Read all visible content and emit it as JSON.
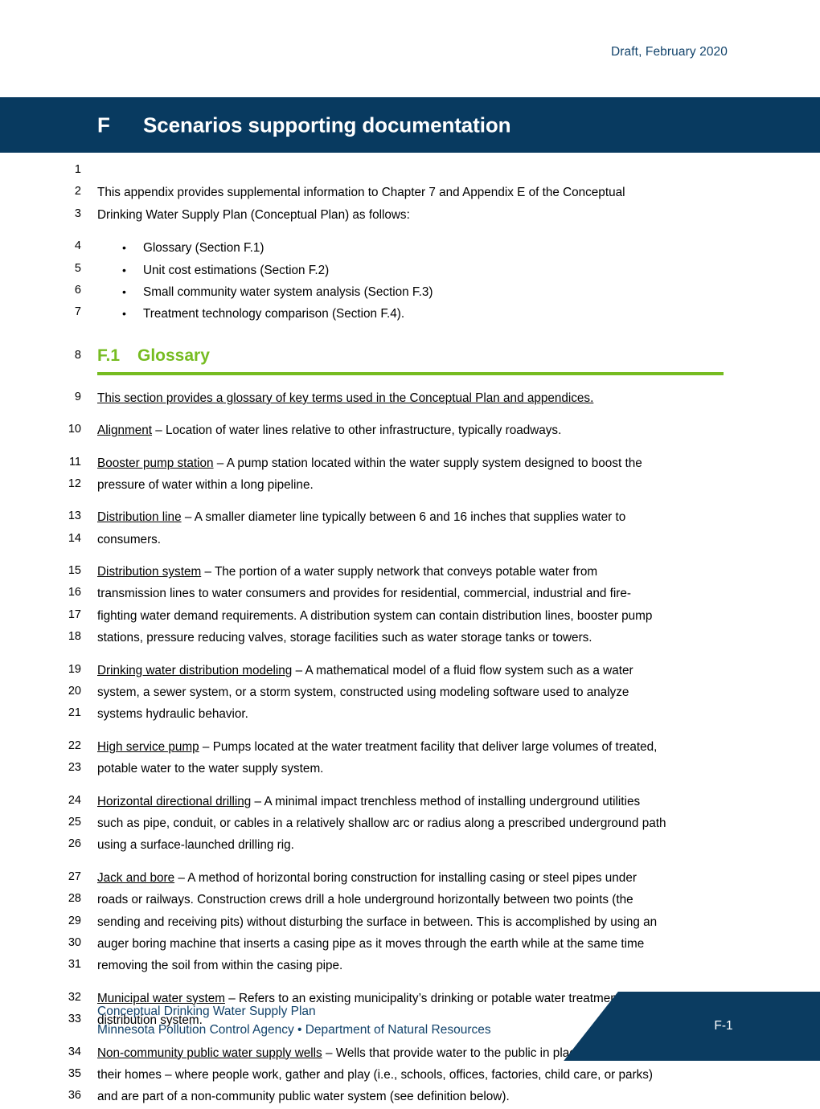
{
  "header": {
    "draft_label": "Draft, February 2020"
  },
  "title_banner": {
    "number": "F",
    "text": "Scenarios supporting documentation"
  },
  "intro": {
    "lines": [
      {
        "num": "1",
        "text": ""
      },
      {
        "num": "2",
        "text": "This appendix provides supplemental information to Chapter 7 and Appendix E of the Conceptual"
      },
      {
        "num": "3",
        "text": "Drinking Water Supply Plan (Conceptual Plan) as follows:"
      }
    ]
  },
  "bullets": {
    "marker": "•",
    "items": [
      {
        "num": "4",
        "text": "Glossary (Section F.1)"
      },
      {
        "num": "5",
        "text": "Unit cost estimations (Section F.2)"
      },
      {
        "num": "6",
        "text": "Small community water system analysis (Section F.3)"
      },
      {
        "num": "7",
        "text": "Treatment technology comparison (Section F.4)."
      }
    ]
  },
  "section": {
    "num_line": "8",
    "number": "F.1",
    "title": "Glossary",
    "rule_color": "#76bc21"
  },
  "glossary": {
    "intro": {
      "num": "9",
      "text": "This section provides a glossary of key terms used in the Conceptual Plan and appendices."
    },
    "entries": [
      {
        "term": "Alignment",
        "lines": [
          {
            "num": "10",
            "term": "Alignment",
            "rest": " – Location of water lines relative to other infrastructure, typically roadways."
          }
        ]
      },
      {
        "term": "Booster pump station",
        "lines": [
          {
            "num": "11",
            "term": "Booster pump station",
            "rest": " – A pump station located within the water supply system designed to boost the"
          },
          {
            "num": "12",
            "term": "",
            "rest": "pressure of water within a long pipeline."
          }
        ]
      },
      {
        "term": "Distribution line",
        "lines": [
          {
            "num": "13",
            "term": "Distribution line",
            "rest": " – A smaller diameter line typically between 6 and 16 inches that supplies water to"
          },
          {
            "num": "14",
            "term": "",
            "rest": "consumers."
          }
        ]
      },
      {
        "term": "Distribution system",
        "lines": [
          {
            "num": "15",
            "term": "Distribution system",
            "rest": " – The portion of a water supply network that conveys potable water from"
          },
          {
            "num": "16",
            "term": "",
            "rest": "transmission lines to water consumers and provides for residential, commercial, industrial and fire-"
          },
          {
            "num": "17",
            "term": "",
            "rest": "fighting water demand requirements. A distribution system can contain distribution lines, booster pump"
          },
          {
            "num": "18",
            "term": "",
            "rest": "stations, pressure reducing valves, storage facilities such as water storage tanks or towers."
          }
        ]
      },
      {
        "term": "Drinking water distribution modeling",
        "lines": [
          {
            "num": "19",
            "term": "Drinking water distribution modeling",
            "rest": " – A mathematical model of a fluid flow system such as a water"
          },
          {
            "num": "20",
            "term": "",
            "rest": "system, a sewer system, or a storm system, constructed using modeling software used to analyze"
          },
          {
            "num": "21",
            "term": "",
            "rest": "systems hydraulic behavior."
          }
        ]
      },
      {
        "term": "High service pump",
        "lines": [
          {
            "num": "22",
            "term": "High service pump",
            "rest": " – Pumps located at the water treatment facility that deliver large volumes of treated,"
          },
          {
            "num": "23",
            "term": "",
            "rest": "potable water to the water supply system."
          }
        ]
      },
      {
        "term": "Horizontal directional drilling",
        "lines": [
          {
            "num": "24",
            "term": "Horizontal directional drilling",
            "rest": " – A minimal impact trenchless method of installing underground utilities"
          },
          {
            "num": "25",
            "term": "",
            "rest": "such as pipe, conduit, or cables in a relatively shallow arc or radius along a prescribed underground path"
          },
          {
            "num": "26",
            "term": "",
            "rest": "using a surface-launched drilling rig."
          }
        ]
      },
      {
        "term": "Jack and bore",
        "lines": [
          {
            "num": "27",
            "term": "Jack and bore",
            "rest": " – A method of horizontal boring construction for installing casing or steel pipes under"
          },
          {
            "num": "28",
            "term": "",
            "rest": "roads or railways. Construction crews drill a hole underground horizontally between two points (the"
          },
          {
            "num": "29",
            "term": "",
            "rest": "sending and receiving pits) without disturbing the surface in between. This is accomplished by using an"
          },
          {
            "num": "30",
            "term": "",
            "rest": "auger boring machine that inserts a casing pipe as it moves through the earth while at the same time"
          },
          {
            "num": "31",
            "term": "",
            "rest": "removing the soil from within the casing pipe."
          }
        ]
      },
      {
        "term": "Municipal water system",
        "lines": [
          {
            "num": "32",
            "term": "Municipal water system",
            "rest": " – Refers to an existing municipality’s drinking or potable water treatment and"
          },
          {
            "num": "33",
            "term": "",
            "rest": "distribution system."
          }
        ]
      },
      {
        "term": "Non-community public water supply wells",
        "lines": [
          {
            "num": "34",
            "term": "Non-community public water supply wells",
            "rest": " – Wells that provide water to the public in places other than"
          },
          {
            "num": "35",
            "term": "",
            "rest": "their homes – where people work, gather and play (i.e., schools, offices, factories, child care, or parks)"
          },
          {
            "num": "36",
            "term": "",
            "rest": "and are part of a non-community public water system (see definition below)."
          }
        ]
      }
    ]
  },
  "footer": {
    "line1": "Conceptual Drinking Water Supply Plan",
    "line2": "Minnesota Pollution Control Agency • Department of Natural Resources",
    "page": "F-1"
  },
  "colors": {
    "navy": "#083a60",
    "navy_text": "#12436b",
    "green": "#76bc21"
  }
}
